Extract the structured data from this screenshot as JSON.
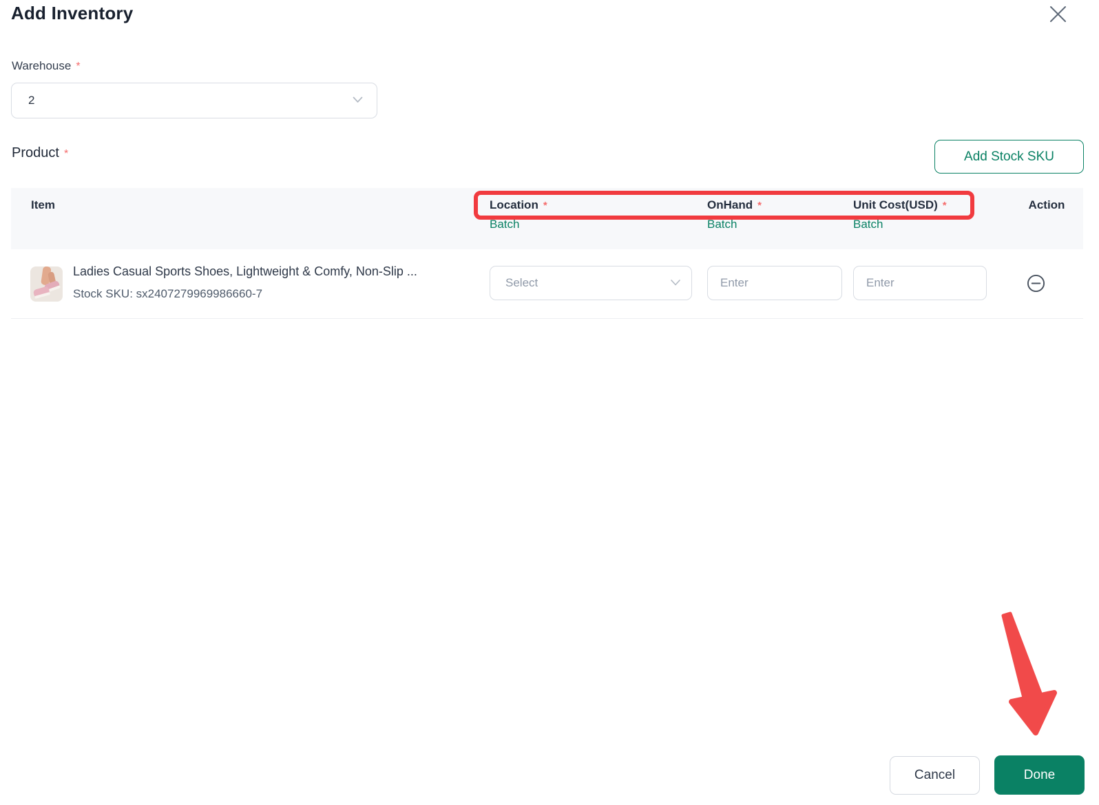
{
  "modal": {
    "title": "Add Inventory"
  },
  "required_mark": "*",
  "warehouse": {
    "label": "Warehouse",
    "value": "2"
  },
  "product_section": {
    "label": "Product",
    "add_button": "Add Stock SKU"
  },
  "table": {
    "headers": {
      "item": "Item",
      "location": "Location",
      "onhand": "OnHand",
      "unit_cost": "Unit Cost(USD)",
      "action": "Action",
      "batch": "Batch"
    },
    "row": {
      "title": "Ladies Casual Sports Shoes, Lightweight & Comfy, Non-Slip ...",
      "sku": "Stock SKU: sx2407279969986660-7",
      "location_placeholder": "Select",
      "onhand_placeholder": "Enter",
      "unit_cost_placeholder": "Enter"
    }
  },
  "footer": {
    "cancel": "Cancel",
    "done": "Done"
  },
  "icons": {
    "close": "x-icon",
    "dropdown": "chevron-down-icon",
    "remove_row": "minus-circle-icon",
    "annotation_arrow": "red-arrow"
  },
  "colors": {
    "accent_green": "#0a8164",
    "annotation_red": "#f13b3f",
    "required_red": "#f56c6c"
  }
}
